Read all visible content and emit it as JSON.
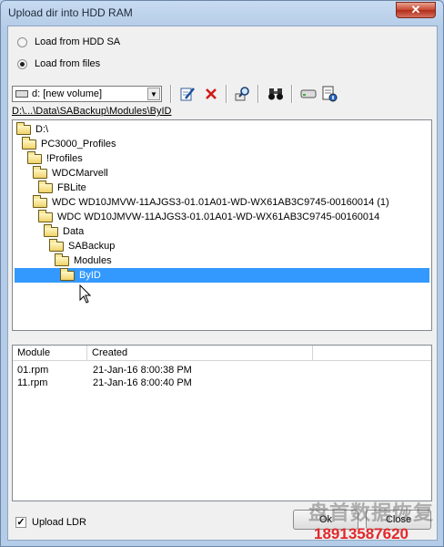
{
  "window": {
    "title": "Upload dir into HDD RAM",
    "close_glyph": "✕"
  },
  "source": {
    "options": [
      {
        "label": "Load from HDD SA",
        "checked": false
      },
      {
        "label": "Load from files",
        "checked": true
      }
    ]
  },
  "toolbar": {
    "drive_value": "d: [new volume]",
    "buttons": [
      "edit-icon",
      "delete-icon",
      "find-icon",
      "binoculars-icon",
      "drive-icon",
      "properties-icon"
    ]
  },
  "path": "D:\\...\\Data\\SABackup\\Modules\\ByID",
  "tree": {
    "items": [
      {
        "label": "D:\\",
        "depth": 0
      },
      {
        "label": "PC3000_Profiles",
        "depth": 1
      },
      {
        "label": "!Profiles",
        "depth": 2
      },
      {
        "label": "WDCMarvell",
        "depth": 3
      },
      {
        "label": "FBLite",
        "depth": 4
      },
      {
        "label": "WDC WD10JMVW-11AJGS3-01.01A01-WD-WX61AB3C9745-00160014 (1)",
        "depth": 5
      },
      {
        "label": "WDC WD10JMVW-11AJGS3-01.01A01-WD-WX61AB3C9745-00160014",
        "depth": 6
      },
      {
        "label": "Data",
        "depth": 7
      },
      {
        "label": "SABackup",
        "depth": 8
      },
      {
        "label": "Modules",
        "depth": 9
      },
      {
        "label": "ByID",
        "depth": 10,
        "selected": true
      }
    ]
  },
  "files": {
    "columns": [
      "Module",
      "Created"
    ],
    "rows": [
      {
        "module": "01.rpm",
        "created": "21-Jan-16 8:00:38 PM"
      },
      {
        "module": "11.rpm",
        "created": "21-Jan-16 8:00:40 PM"
      }
    ]
  },
  "footer": {
    "upload_ldr_label": "Upload LDR",
    "upload_ldr_checked": true,
    "check_glyph": "✓",
    "ok_label": "Ok",
    "close_label": "Close"
  },
  "watermark": {
    "logo_text": "盘首数据恢复",
    "phone": "18913587620"
  },
  "colors": {
    "selection": "#3399ff",
    "window_frame": "#b4cce7",
    "close_button": "#c7462f"
  }
}
